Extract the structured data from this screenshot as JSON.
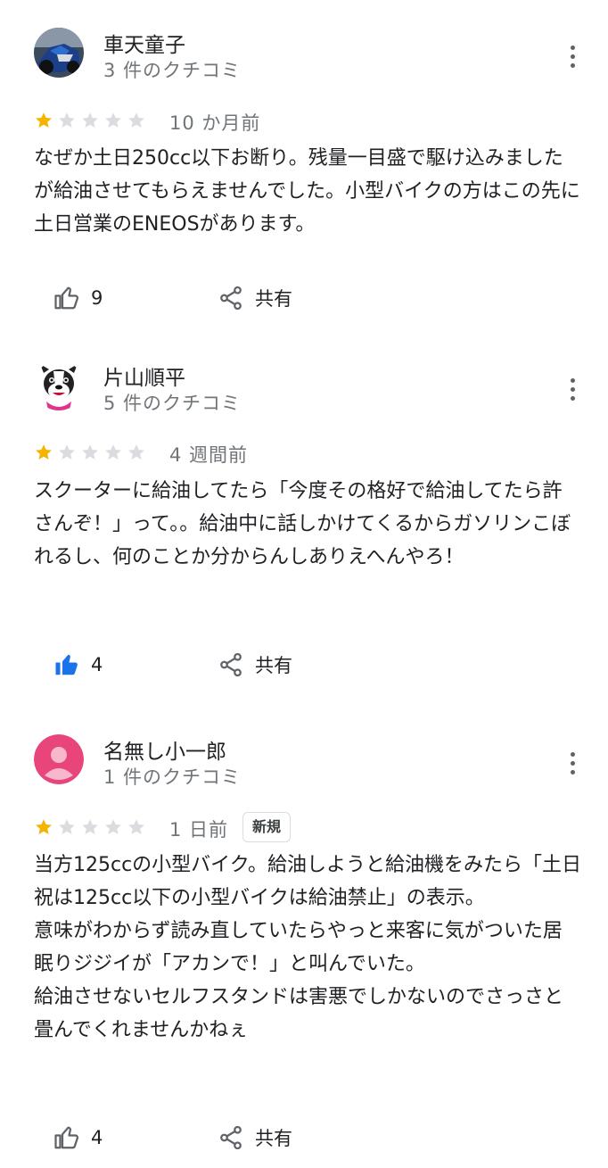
{
  "reviews": [
    {
      "name": "車天童子",
      "count": "3 件のクチコミ",
      "rating": 1,
      "time": "10 か月前",
      "badge": "",
      "text": "なぜか土日250cc以下お断り。残量一目盛で駆け込みましたが給油させてもらえませんでした。小型バイクの方はこの先に土日営業のENEOSがあります。",
      "likes": "9",
      "liked": false,
      "share_label": "共有",
      "avatar_icon": "motorcycle-photo-avatar"
    },
    {
      "name": "片山順平",
      "count": "5 件のクチコミ",
      "rating": 1,
      "time": "4 週間前",
      "badge": "",
      "text": "スクーターに給油してたら「今度その格好で給油してたら許さんぞ！」って。。給油中に話しかけてくるからガソリンこぼれるし、何のことか分からんしありえへんやろ！",
      "likes": "4",
      "liked": true,
      "share_label": "共有",
      "avatar_icon": "bulldog-avatar"
    },
    {
      "name": "名無し小一郎",
      "count": "1 件のクチコミ",
      "rating": 1,
      "time": "1 日前",
      "badge": "新規",
      "text": "当方125ccの小型バイク。給油しようと給油機をみたら「土日祝は125cc以下の小型バイクは給油禁止」の表示。\n意味がわからず読み直していたらやっと来客に気がついた居眠りジジイが「アカンで！」と叫んでいた。\n給油させないセルフスタンドは害悪でしかないのでさっさと畳んでくれませんかねぇ",
      "likes": "4",
      "liked": false,
      "share_label": "共有",
      "avatar_icon": "default-person-avatar"
    }
  ],
  "colors": {
    "star_filled": "#f4b400",
    "star_empty": "#dadce0",
    "like_active": "#1a73e8",
    "avatar_pink": "#e8457a"
  }
}
